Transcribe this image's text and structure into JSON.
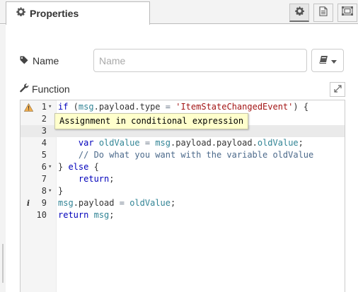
{
  "tab": {
    "title": "Properties",
    "icon": "gear-icon"
  },
  "toolbar": {
    "buttons": [
      {
        "icon": "gear-icon",
        "selected": true
      },
      {
        "icon": "document-icon",
        "selected": false
      },
      {
        "icon": "appearance-icon",
        "selected": false
      }
    ]
  },
  "name_field": {
    "label": "Name",
    "placeholder": "Name",
    "value": "",
    "icon": "tag-icon"
  },
  "library_button": {
    "icon": "book-icon",
    "caret_icon": "caret-down-icon"
  },
  "function_field": {
    "label": "Function",
    "icon": "wrench-icon",
    "expand_icon": "expand-icon"
  },
  "editor": {
    "active_line": 3,
    "tooltip": "Assignment in conditional expression",
    "lines": [
      {
        "number": "1",
        "marker": "warning",
        "fold": true,
        "text": "if (msg.payload.type = 'ItemStateChangedEvent') {"
      },
      {
        "number": "2",
        "marker": "",
        "fold": false,
        "text": ""
      },
      {
        "number": "3",
        "marker": "",
        "fold": false,
        "text": ""
      },
      {
        "number": "4",
        "marker": "",
        "fold": false,
        "text": "    var oldValue = msg.payload.payload.oldValue;"
      },
      {
        "number": "5",
        "marker": "",
        "fold": false,
        "text": "    // Do what you want with the variable oldValue"
      },
      {
        "number": "6",
        "marker": "",
        "fold": true,
        "text": "} else {"
      },
      {
        "number": "7",
        "marker": "",
        "fold": false,
        "text": "    return;"
      },
      {
        "number": "8",
        "marker": "",
        "fold": true,
        "text": "}"
      },
      {
        "number": "9",
        "marker": "info",
        "fold": false,
        "text": "msg.payload = oldValue;"
      },
      {
        "number": "10",
        "marker": "",
        "fold": false,
        "text": "return msg;"
      }
    ]
  },
  "colors": {
    "keyword": "#0000bb",
    "variable": "#318495",
    "string": "#a31515",
    "comment": "#4c6a8b",
    "warning": "#f0ad4e",
    "tooltip_bg": "#ffffcc"
  }
}
